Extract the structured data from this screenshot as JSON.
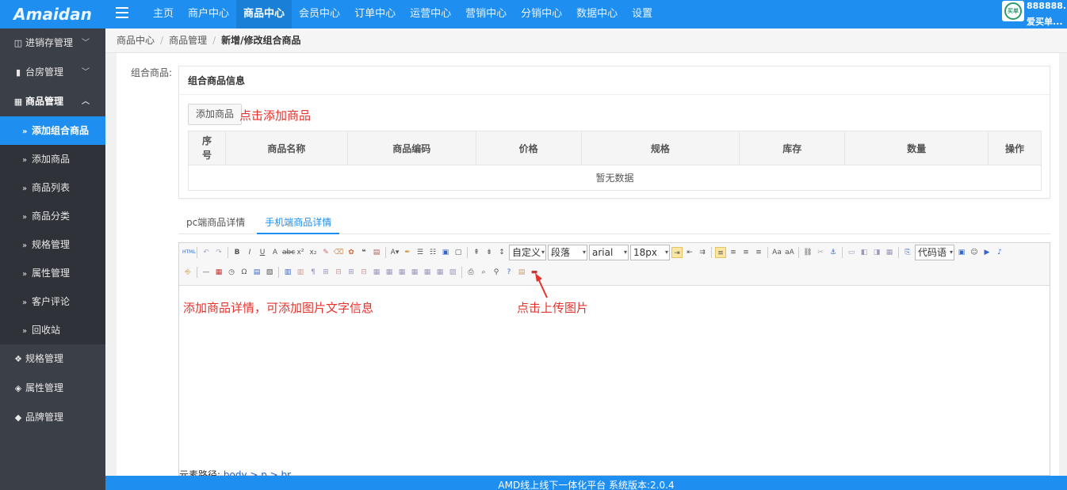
{
  "brand": {
    "logo_text": "Amaidan"
  },
  "topnav": {
    "items": [
      "主页",
      "商户中心",
      "商品中心",
      "会员中心",
      "订单中心",
      "运营中心",
      "营销中心",
      "分销中心",
      "数据中心",
      "设置"
    ],
    "active": "商品中心"
  },
  "user": {
    "avatar_text": "买单",
    "line1": "888888...",
    "line2": "爱买单..."
  },
  "sidebar": {
    "groups_top": [
      {
        "label": "进销存管理",
        "icon": "map-icon"
      },
      {
        "label": "台房管理",
        "icon": "bookmark-icon"
      },
      {
        "label": "商品管理",
        "icon": "grid-icon"
      }
    ],
    "sub_items": [
      "添加组合商品",
      "添加商品",
      "商品列表",
      "商品分类",
      "规格管理",
      "属性管理",
      "客户评论",
      "回收站"
    ],
    "groups_bottom": [
      {
        "label": "规格管理",
        "icon": "cubes-icon"
      },
      {
        "label": "属性管理",
        "icon": "cube-icon"
      },
      {
        "label": "品牌管理",
        "icon": "tags-icon"
      }
    ]
  },
  "breadcrumb": {
    "items": [
      "商品中心",
      "商品管理"
    ],
    "current": "新增/修改组合商品"
  },
  "form": {
    "label": "组合商品:",
    "panel_title": "组合商品信息",
    "add_button": "添加商品",
    "annotation_add": "点击添加商品",
    "table": {
      "headers": [
        "序号",
        "商品名称",
        "商品编码",
        "价格",
        "规格",
        "库存",
        "数量",
        "操作"
      ],
      "empty_text": "暂无数据"
    }
  },
  "tabs": {
    "items": [
      "pc端商品详情",
      "手机端商品详情"
    ],
    "active": "手机端商品详情"
  },
  "editor": {
    "selects": {
      "custom": "自定义",
      "paragraph": "段落",
      "font": "arial",
      "size": "18px",
      "code": "代码语"
    },
    "annotation_detail": "添加商品详情，可添加图片文字信息",
    "annotation_upload": "点击上传图片",
    "path_label": "元素路径:",
    "path_value": "body > p > br"
  },
  "footer": {
    "text": "AMD线上线下一体化平台 系统版本:2.0.4"
  },
  "colors": {
    "primary": "#1e8ff0",
    "sidebar": "#3b3f47",
    "annotation": "#e5322d"
  }
}
